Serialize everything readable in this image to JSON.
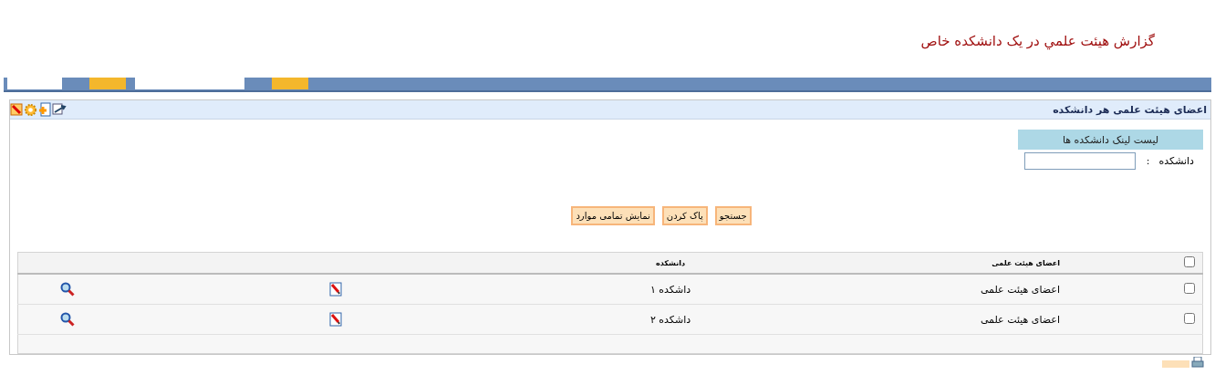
{
  "page_title": "گزارش هيئت علمي در يک دانشکده خاص",
  "panel": {
    "title": "اعضای هیئت علمی هر دانشکده"
  },
  "list_link": "لیست لینک دانشکده ها",
  "filter": {
    "label": "دانشکده",
    "colon": ":"
  },
  "buttons": [
    "جستجو",
    "پاک کردن",
    "نمایش تمامی موارد"
  ],
  "table": {
    "select_all_checked": false,
    "columns": [
      "اعضای هیئت علمی",
      "دانشکده"
    ],
    "rows": [
      {
        "checked": false,
        "cells": [
          "اعضای هیئت علمی",
          "داشکده ۱"
        ]
      },
      {
        "checked": false,
        "cells": [
          "اعضای هیئت علمی",
          "داشکده ۲"
        ]
      }
    ]
  }
}
